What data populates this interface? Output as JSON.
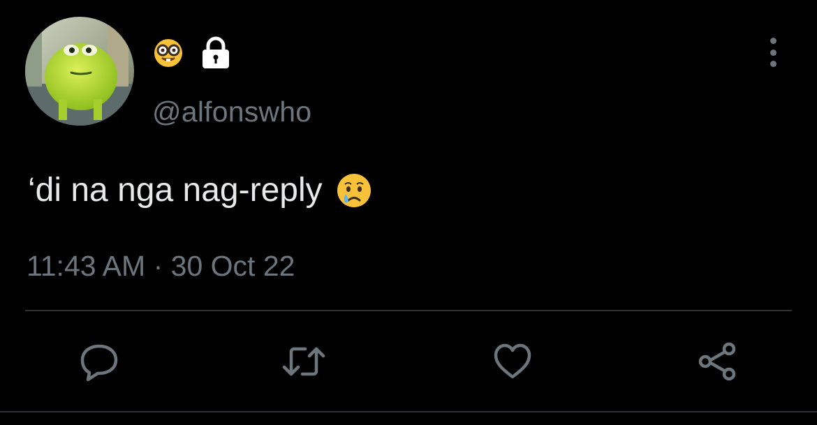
{
  "author": {
    "avatar_icon": "avatar-image",
    "name_emoji": "nerd-face-emoji",
    "lock_icon": "lock-icon",
    "handle": "@alfonswho"
  },
  "tweet": {
    "text": "‘di na nga nag-reply",
    "emoji": "crying-face-emoji",
    "time": "11:43 AM",
    "separator": "·",
    "date": "30 Oct 22"
  },
  "actions": {
    "icons": [
      "reply-icon",
      "retweet-icon",
      "like-icon",
      "share-icon"
    ]
  },
  "colors": {
    "background": "#000000",
    "primary_text": "#e7e9ea",
    "secondary_text": "#6e767d",
    "divider": "#2f3336"
  }
}
